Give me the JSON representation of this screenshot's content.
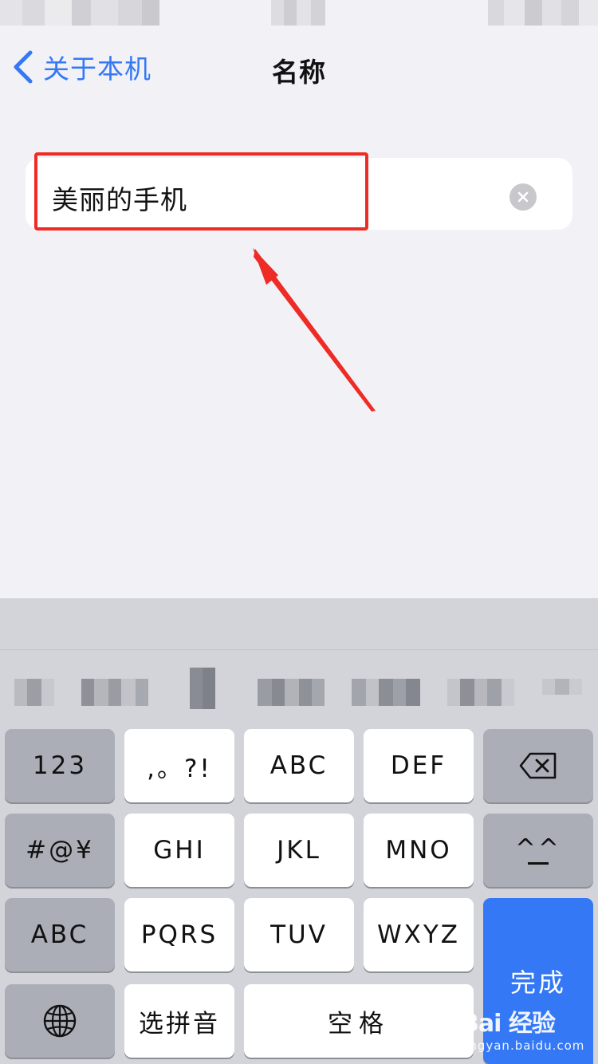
{
  "nav": {
    "back_label": "关于本机",
    "title": "名称"
  },
  "name_field": {
    "value": "美丽的手机"
  },
  "keyboard": {
    "rows": [
      [
        {
          "label": "123",
          "style": "dark"
        },
        {
          "label": ",。?!",
          "style": "light"
        },
        {
          "label": "ABC",
          "style": "light"
        },
        {
          "label": "DEF",
          "style": "light"
        },
        {
          "label": "",
          "icon": "delete-icon",
          "style": "dark"
        }
      ],
      [
        {
          "label": "#@¥",
          "style": "dark"
        },
        {
          "label": "GHI",
          "style": "light"
        },
        {
          "label": "JKL",
          "style": "light"
        },
        {
          "label": "MNO",
          "style": "light"
        },
        {
          "label": "^^",
          "style": "dark"
        }
      ],
      [
        {
          "label": "ABC",
          "style": "dark"
        },
        {
          "label": "PQRS",
          "style": "light"
        },
        {
          "label": "TUV",
          "style": "light"
        },
        {
          "label": "WXYZ",
          "style": "light"
        }
      ],
      [
        {
          "label": "",
          "icon": "globe-icon",
          "style": "dark"
        },
        {
          "label": "选拼音",
          "style": "light"
        },
        {
          "label": "空格",
          "style": "light"
        }
      ]
    ],
    "done_label": "完成"
  },
  "watermark": {
    "brand": "Bai 经验",
    "url": "jingyan.baidu.com"
  },
  "colors": {
    "accent": "#3478f6",
    "annotation": "#ee2b24",
    "background": "#f1f1f6",
    "keyboard_bg": "#d3d4da"
  }
}
